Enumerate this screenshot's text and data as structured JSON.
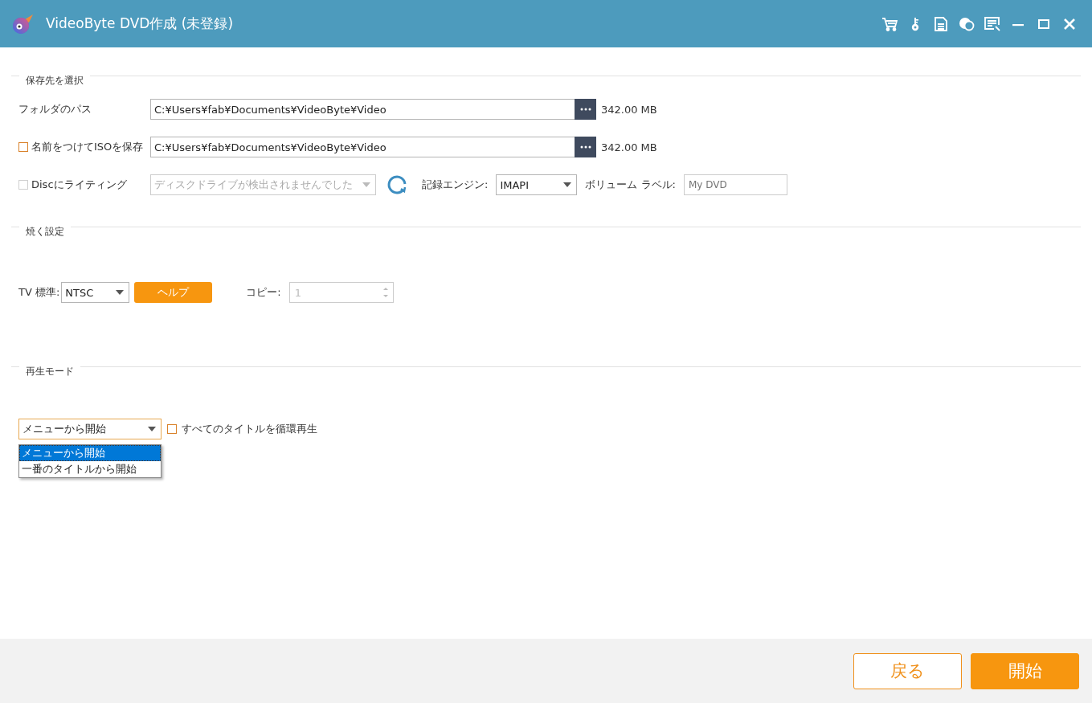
{
  "window": {
    "title": "VideoByte DVD作成 (未登録)"
  },
  "destination": {
    "legend": "保存先を選択",
    "folder": {
      "label": "フォルダのパス",
      "value": "C:¥Users¥fab¥Documents¥VideoByte¥Video",
      "size": "342.00 MB"
    },
    "iso": {
      "label": "名前をつけてISOを保存",
      "checked": false,
      "value": "C:¥Users¥fab¥Documents¥VideoByte¥Video",
      "size": "342.00 MB"
    },
    "disc": {
      "label": "Discにライティング",
      "checked": false,
      "disabled": true,
      "drive": "ディスクドライブが検出されませんでした",
      "engine_label": "記録エンジン:",
      "engine": "IMAPI",
      "volume_label": "ボリューム ラベル:",
      "volume_placeholder": "My DVD"
    }
  },
  "burn": {
    "legend": "焼く設定",
    "tv_label": "TV 標準:",
    "tv": "NTSC",
    "help": "ヘルプ",
    "copies": {
      "label": "コピー:",
      "value": "1",
      "disabled": true
    }
  },
  "playback": {
    "legend": "再生モード",
    "mode": "メニューから開始",
    "options": [
      {
        "label": "メニューから開始",
        "selected": true
      },
      {
        "label": "一番のタイトルから開始",
        "selected": false
      }
    ],
    "loop": {
      "label": "すべてのタイトルを循環再生",
      "checked": false
    }
  },
  "footer": {
    "buttons": [
      {
        "label": "戻る",
        "kind": "secondary"
      },
      {
        "label": "開始",
        "kind": "primary"
      }
    ]
  }
}
